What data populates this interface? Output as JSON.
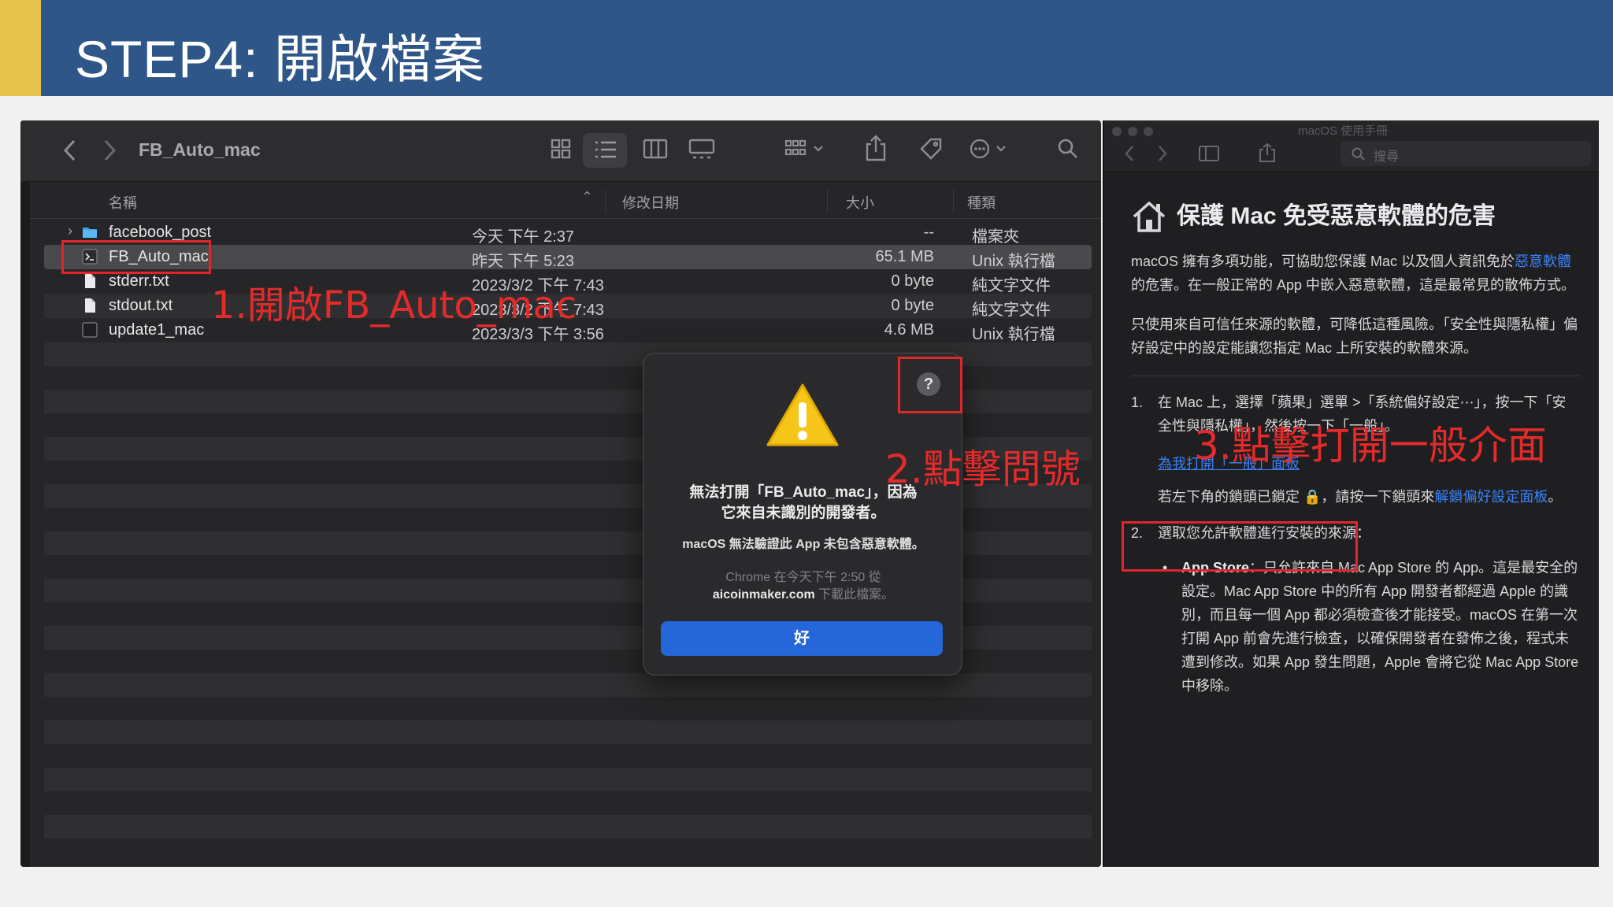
{
  "slide": {
    "title": "STEP4: 開啟檔案",
    "colors": {
      "header_bg": "#2e5689",
      "accent": "#e7c24c",
      "annotation": "#e0262a"
    }
  },
  "finder": {
    "window_title": "FB_Auto_mac",
    "columns": {
      "name": "名稱",
      "date": "修改日期",
      "size": "大小",
      "kind": "種類"
    },
    "files": [
      {
        "name": "facebook_post",
        "date": "今天 下午 2:37",
        "size": "--",
        "kind": "檔案夾",
        "icon": "folder-icon"
      },
      {
        "name": "FB_Auto_mac",
        "date": "昨天 下午 5:23",
        "size": "65.1 MB",
        "kind": "Unix 執行檔",
        "icon": "executable-icon"
      },
      {
        "name": "stderr.txt",
        "date": "2023/3/2 下午 7:43",
        "size": "0 byte",
        "kind": "純文字文件",
        "icon": "document-icon"
      },
      {
        "name": "stdout.txt",
        "date": "2023/3/2 下午 7:43",
        "size": "0 byte",
        "kind": "純文字文件",
        "icon": "document-icon"
      },
      {
        "name": "update1_mac",
        "date": "2023/3/3 下午 3:56",
        "size": "4.6 MB",
        "kind": "Unix 執行檔",
        "icon": "executable-icon"
      }
    ]
  },
  "dialog": {
    "title_line1": "無法打開「FB_Auto_mac」，因為",
    "title_line2": "它來自未識別的開發者。",
    "message": "macOS 無法驗證此 App 未包含惡意軟體。",
    "source_line1": "Chrome 在今天下午 2:50 從",
    "source_domain": "aicoinmaker.com",
    "source_suffix": " 下載此檔案。",
    "ok_label": "好",
    "help_label": "?"
  },
  "help": {
    "window_title": "macOS 使用手冊",
    "search_placeholder": "搜尋",
    "heading": "保護 Mac 免受惡意軟體的危害",
    "p1_a": "macOS 擁有多項功能，可協助您保護 Mac 以及個人資訊免於",
    "p1_link": "惡意軟體",
    "p1_b": "的危害。在一般正常的 App 中嵌入惡意軟體，這是最常見的散佈方式。",
    "p2": "只使用來自可信任來源的軟體，可降低這種風險。「安全性與隱私權」偏好設定中的設定能讓您指定 Mac 上所安裝的軟體來源。",
    "step1_num": "1.",
    "step1_text": "在 Mac 上，選擇「蘋果」選單  >「系統偏好設定⋯」，按一下「安全性與隱私權」，然後按一下「一般」。",
    "open_general_link": "為我打開「一般」面板",
    "lock_text": "若左下角的鎖頭已鎖定 🔒，請按一下鎖頭來",
    "unlock_link": "解鎖偏好設定面板",
    "lock_suffix": "。",
    "step2_num": "2.",
    "step2_text": "選取您允許軟體進行安裝的來源：",
    "bullet_label": "App Store",
    "bullet_text": "：只允許來自 Mac App Store 的 App。這是最安全的設定。Mac App Store 中的所有 App 開發者都經過 Apple 的識別，而且每一個 App 都必須檢查後才能接受。macOS 在第一次打開 App 前會先進行檢查，以確保開發者在發佈之後，程式未遭到修改。如果 App 發生問題，Apple 會將它從 Mac App Store 中移除。"
  },
  "annotations": {
    "a1": "1.開啟FB_Auto_mac",
    "a2": "2.點擊問號",
    "a3": "3.點擊打開一般介面"
  }
}
